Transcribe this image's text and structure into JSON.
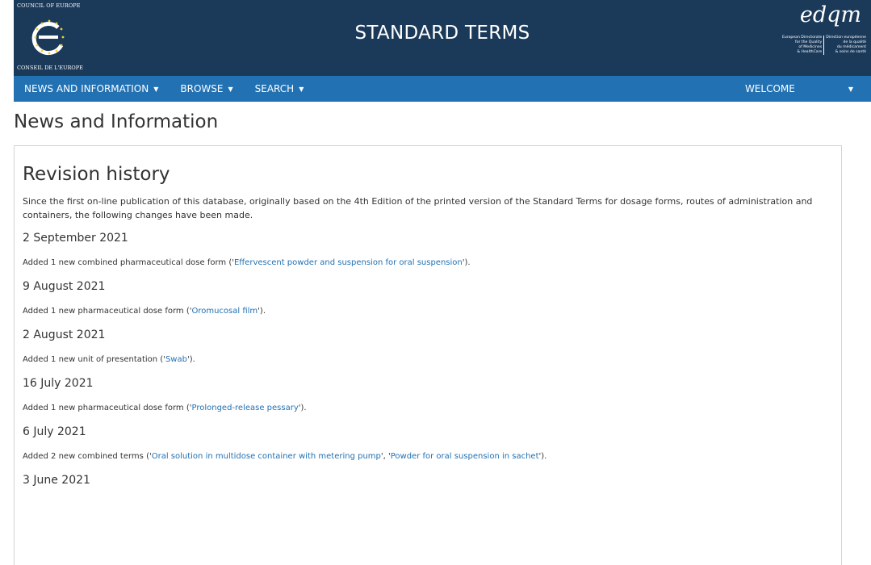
{
  "header": {
    "coe_top": "COUNCIL OF EUROPE",
    "coe_bottom": "CONSEIL DE L'EUROPE",
    "site_title": "STANDARD TERMS",
    "edqm_logo": "edqm",
    "edqm_en": [
      "European Directorate",
      "for the Quality",
      "of Medicines",
      "& HealthCare"
    ],
    "edqm_fr": [
      "Direction européenne",
      "de la qualité",
      "du médicament",
      "& soins de santé"
    ]
  },
  "nav": {
    "items": [
      {
        "label": "NEWS AND INFORMATION"
      },
      {
        "label": "BROWSE"
      },
      {
        "label": "SEARCH"
      }
    ],
    "welcome": "WELCOME"
  },
  "page": {
    "title": "News and Information",
    "section_title": "Revision history",
    "intro": "Since the first on-line publication of this database, originally based on the 4th Edition of the printed version of the Standard Terms for dosage forms, routes of administration and containers, the following changes have been made."
  },
  "entries": [
    {
      "date": "2 September 2021",
      "prefix": "Added 1 new combined pharmaceutical dose form ('",
      "links": [
        "Effervescent powder and suspension for oral suspension"
      ],
      "suffix": "')."
    },
    {
      "date": "9 August 2021",
      "prefix": "Added 1 new pharmaceutical dose form ('",
      "links": [
        "Oromucosal film"
      ],
      "suffix": "')."
    },
    {
      "date": "2 August 2021",
      "prefix": "Added 1 new unit of presentation ('",
      "links": [
        "Swab"
      ],
      "suffix": "')."
    },
    {
      "date": "16 July 2021",
      "prefix": "Added 1 new pharmaceutical dose form ('",
      "links": [
        "Prolonged-release pessary"
      ],
      "suffix": "')."
    },
    {
      "date": "6 July 2021",
      "prefix": "Added 2 new combined terms ('",
      "links": [
        "Oral solution in multidose container with metering pump",
        "Powder for oral suspension in sachet"
      ],
      "middle": "', '",
      "suffix": "')."
    },
    {
      "date": "3 June 2021"
    }
  ],
  "colors": {
    "header_bg": "#1b3a5a",
    "nav_bg": "#2271b3",
    "link": "#2271b3"
  }
}
